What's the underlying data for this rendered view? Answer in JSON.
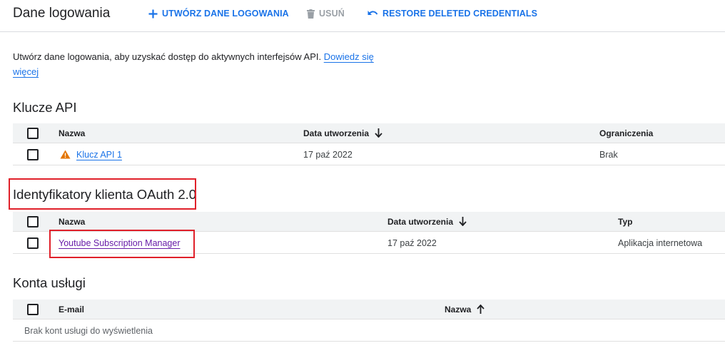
{
  "header": {
    "title": "Dane logowania",
    "create_label": "UTWÓRZ DANE LOGOWANIA",
    "delete_label": "USUŃ",
    "restore_label": "RESTORE DELETED CREDENTIALS"
  },
  "intro": {
    "text": "Utwórz dane logowania, aby uzyskać dostęp do aktywnych interfejsów API. ",
    "link": "Dowiedz się więcej"
  },
  "api_keys": {
    "title": "Klucze API",
    "columns": [
      "Nazwa",
      "Data utworzenia",
      "Ograniczenia"
    ],
    "rows": [
      {
        "name": "Klucz API 1",
        "created": "17 paź 2022",
        "restrictions": "Brak",
        "warning_icon": "warning-icon"
      }
    ]
  },
  "oauth": {
    "title": "Identyfikatory klienta OAuth 2.0",
    "columns": [
      "Nazwa",
      "Data utworzenia",
      "Typ"
    ],
    "rows": [
      {
        "name": "Youtube Subscription Manager",
        "created": "17 paź 2022",
        "type": "Aplikacja internetowa"
      }
    ]
  },
  "service_accounts": {
    "title": "Konta usługi",
    "columns": [
      "E-mail",
      "Nazwa"
    ],
    "empty_text": "Brak kont usługi do wyświetlenia"
  },
  "colors": {
    "accent": "#1a73e8",
    "visited_link": "#681da8",
    "warning": "#e37400",
    "highlight_box": "#e0202a"
  }
}
